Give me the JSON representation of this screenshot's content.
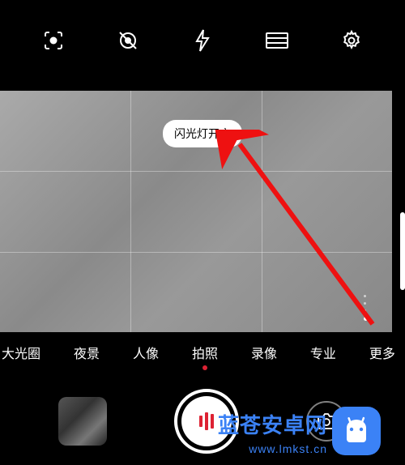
{
  "topbar": {
    "icons": [
      "lens-mode",
      "motion-off",
      "flash",
      "aspect-ratio",
      "settings"
    ]
  },
  "toast_text": "闪光灯开启",
  "modes": {
    "items": [
      "大光圈",
      "夜景",
      "人像",
      "拍照",
      "录像",
      "专业",
      "更多"
    ],
    "active_index": 3
  },
  "bottombar": {
    "thumbnail": "gallery-thumbnail",
    "shutter": "shutter-button",
    "switch": "switch-camera"
  },
  "watermark": {
    "brand": "蓝苍安卓网",
    "url": "www.lmkst.cn"
  }
}
